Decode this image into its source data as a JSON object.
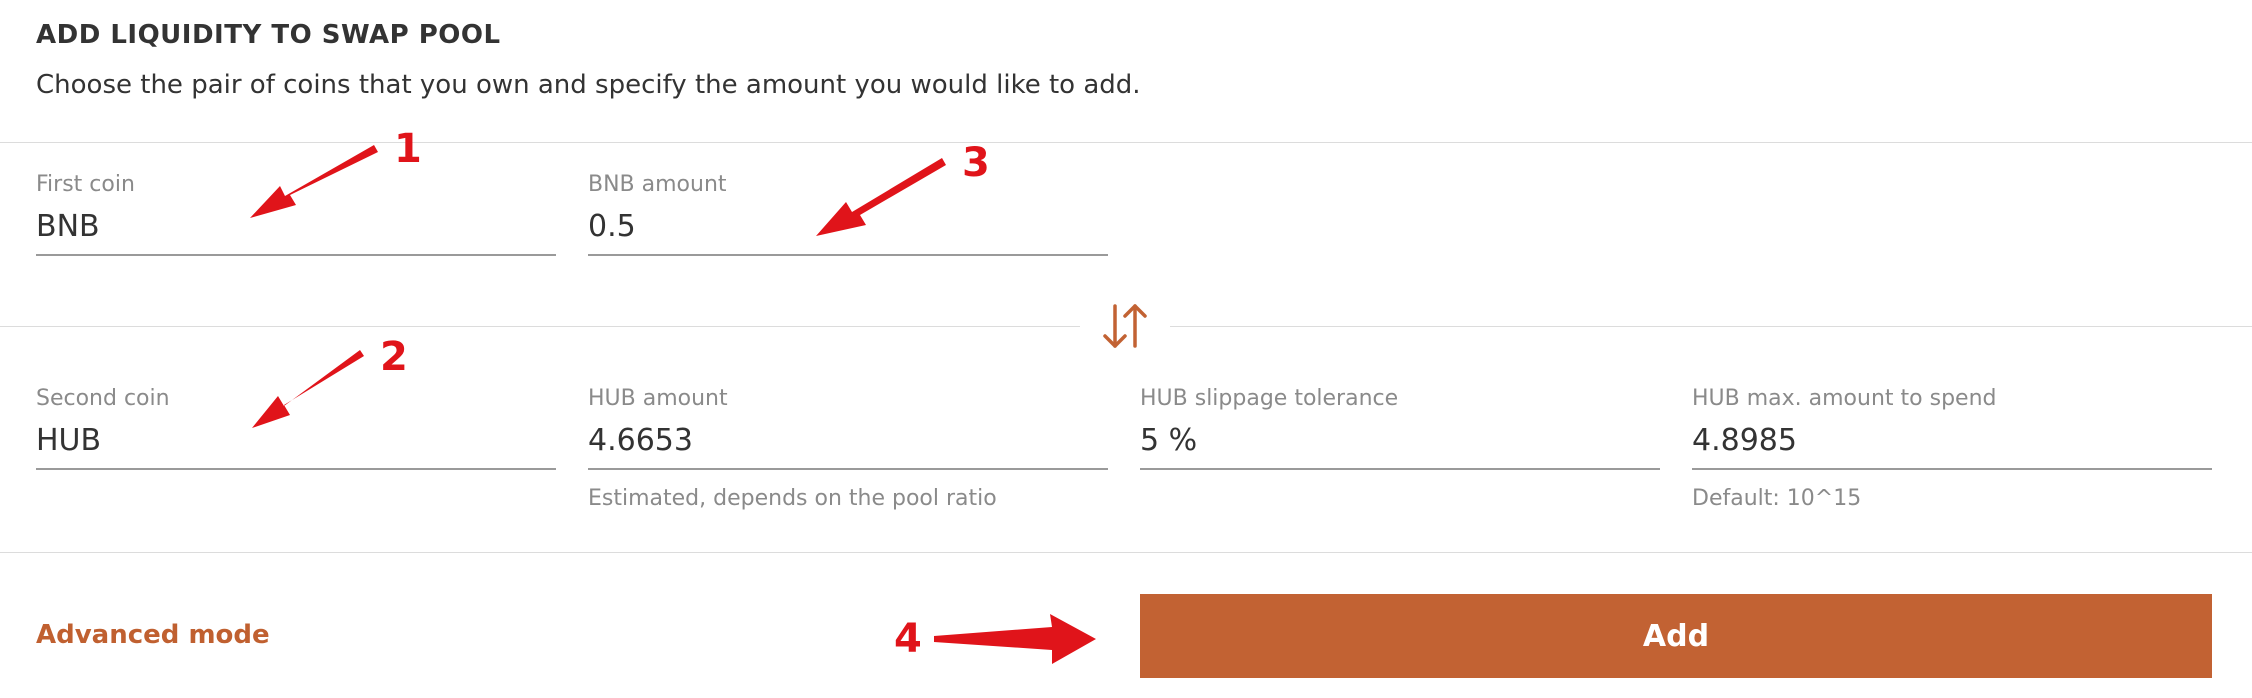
{
  "header": {
    "title": "ADD LIQUIDITY TO SWAP POOL",
    "subtitle": "Choose the pair of coins that you own and specify the amount you would like to add."
  },
  "first_row": {
    "first_coin": {
      "label": "First coin",
      "value": "BNB"
    },
    "first_amount": {
      "label": "BNB amount",
      "value": "0.5"
    }
  },
  "second_row": {
    "second_coin": {
      "label": "Second coin",
      "value": "HUB"
    },
    "second_amount": {
      "label": "HUB amount",
      "value": "4.6653",
      "hint": "Estimated, depends on the pool ratio"
    },
    "slippage": {
      "label": "HUB slippage tolerance",
      "value": "5 %"
    },
    "max_spend": {
      "label": "HUB max. amount to spend",
      "value": "4.8985",
      "hint": "Default: 10^15"
    }
  },
  "footer": {
    "advanced_label": "Advanced mode",
    "add_label": "Add"
  },
  "annotations": {
    "n1": "1",
    "n2": "2",
    "n3": "3",
    "n4": "4"
  },
  "colors": {
    "accent": "#c26233",
    "annotation": "#e0141a"
  },
  "icons": {
    "swap": "swap-arrows-icon"
  }
}
